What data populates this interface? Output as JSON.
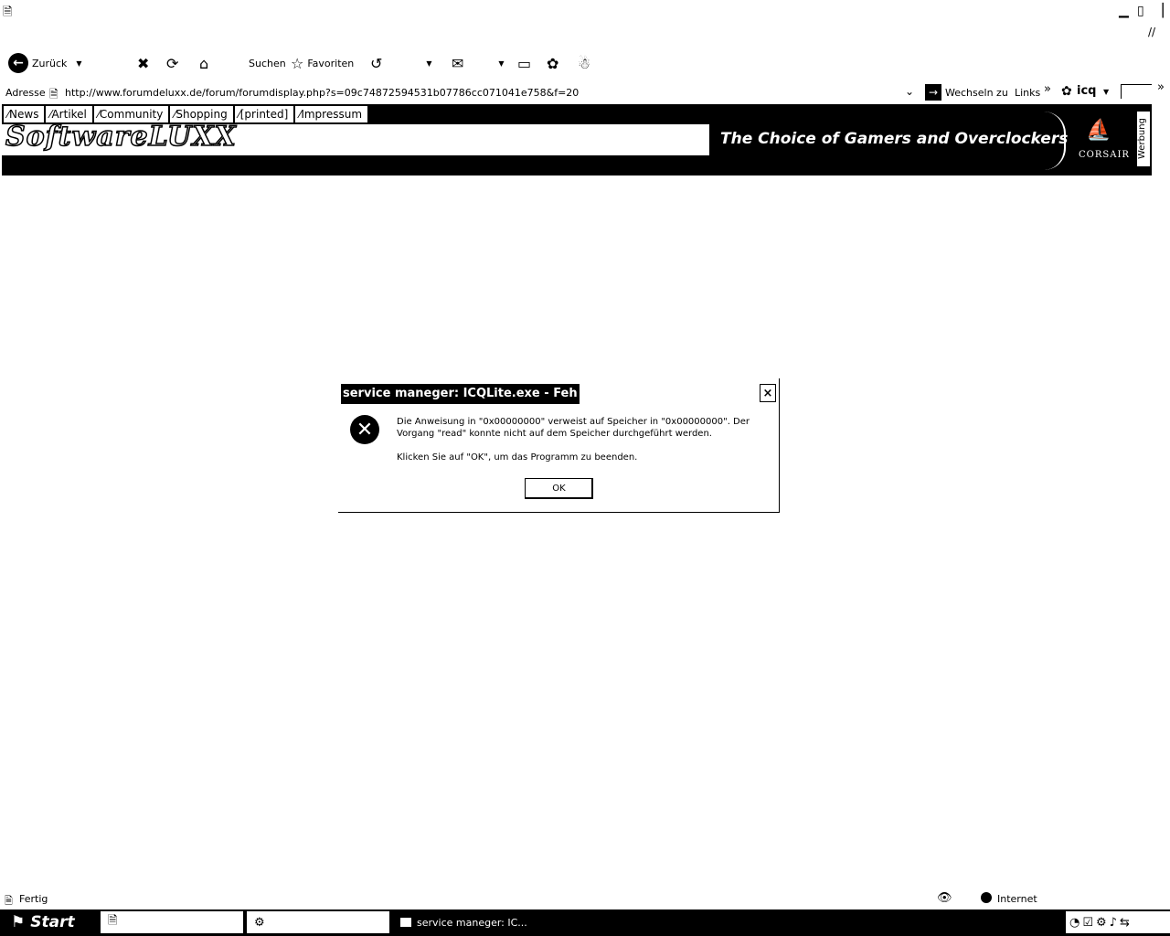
{
  "window": {
    "app_icon": "ie-page-icon",
    "controls": [
      "minimize-icon",
      "maximize-icon",
      "close-icon"
    ]
  },
  "toolbar": {
    "back_label": "Zurück",
    "search_label": "Suchen",
    "favorites_label": "Favoriten"
  },
  "address": {
    "label": "Adresse",
    "url": "http://www.forumdeluxx.de/forum/forumdisplay.php?s=09c74872594531b07786cc071041e758&f=20",
    "go_label": "Wechseln zu",
    "links_label": "Links",
    "links_chevron": "»",
    "icq_label": "icq",
    "more_chevron": "»"
  },
  "site": {
    "nav": [
      {
        "label": "News"
      },
      {
        "label": "Artikel"
      },
      {
        "label": "Community"
      },
      {
        "label": "Shopping"
      },
      {
        "label": "[printed]"
      },
      {
        "label": "Impressum"
      }
    ],
    "logo": "SoftwareLUXX",
    "ad": {
      "slogan": "The Choice of Gamers and Overclockers",
      "brand": "CORSAIR",
      "side_label": "Werbung"
    }
  },
  "dialog": {
    "title": "service maneger: ICQLite.exe - Feh",
    "close_glyph": "×",
    "message": "Die Anweisung in \"0x00000000\" verweist auf Speicher in \"0x00000000\". Der Vorgang \"read\" konnte nicht auf dem Speicher durchgeführt werden.",
    "message2": "Klicken Sie auf \"OK\", um das Programm zu beenden.",
    "ok_label": "OK"
  },
  "status": {
    "text": "Fertig",
    "zone": "Internet"
  },
  "taskbar": {
    "start_label": "Start",
    "tasks": [
      {
        "label": "",
        "icon": "ie-page-icon",
        "state": "inactive"
      },
      {
        "label": "",
        "icon": "steam-icon",
        "state": "inactive"
      },
      {
        "label": "service maneger: IC...",
        "icon": "window-icon",
        "state": "active"
      }
    ]
  }
}
